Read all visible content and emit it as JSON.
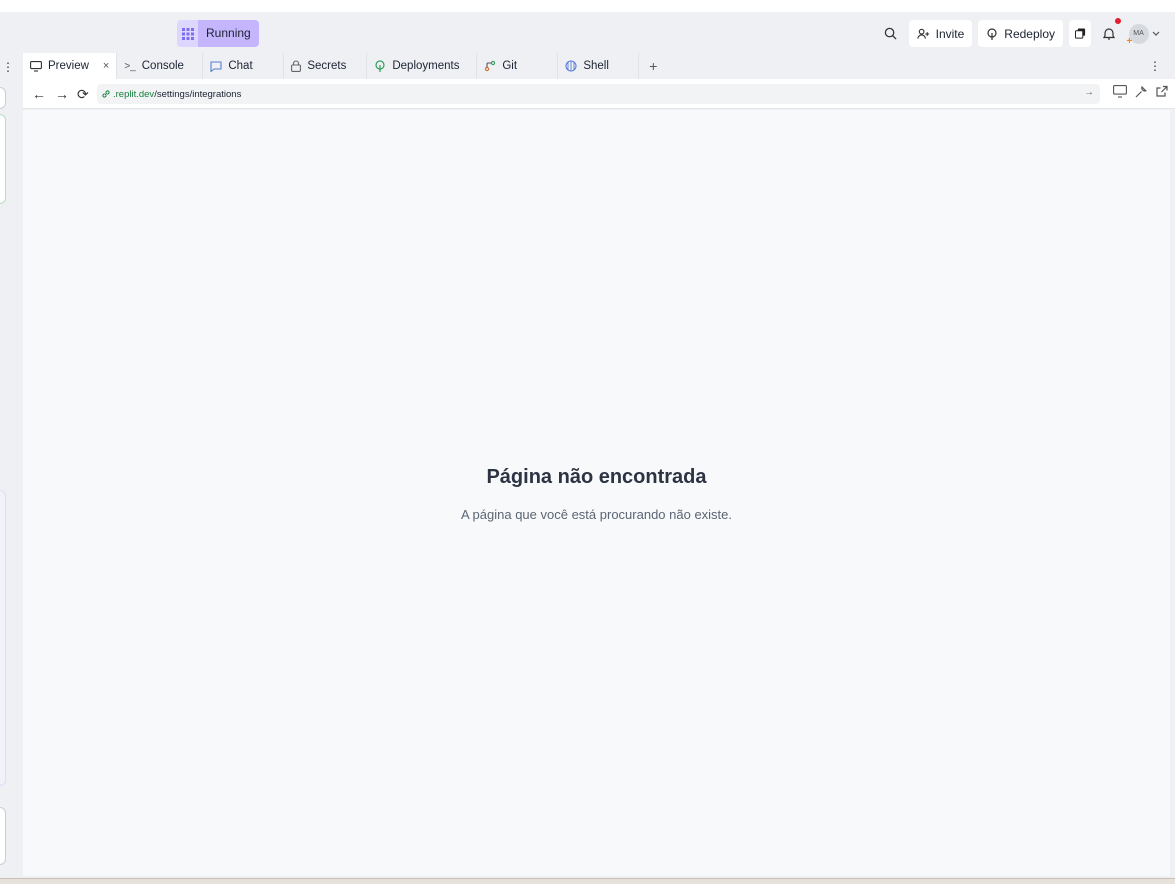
{
  "toolbar": {
    "run_label": "Running",
    "invite_label": "Invite",
    "redeploy_label": "Redeploy",
    "avatar_initials": "MA"
  },
  "tabs": [
    {
      "label": "Preview",
      "icon": "monitor-icon",
      "active": true
    },
    {
      "label": "Console",
      "icon": "terminal-icon"
    },
    {
      "label": "Chat",
      "icon": "chat-icon"
    },
    {
      "label": "Secrets",
      "icon": "lock-icon"
    },
    {
      "label": "Deployments",
      "icon": "deploy-icon"
    },
    {
      "label": "Git",
      "icon": "git-icon"
    },
    {
      "label": "Shell",
      "icon": "shell-icon"
    }
  ],
  "address": {
    "host": ".replit.dev",
    "path": "/settings/integrations"
  },
  "page": {
    "title": "Página não encontrada",
    "subtitle": "A página que você está procurando não existe."
  },
  "colors": {
    "accent": "#c4b5fd",
    "link_green": "#15803d",
    "notification": "#e11d2f"
  }
}
